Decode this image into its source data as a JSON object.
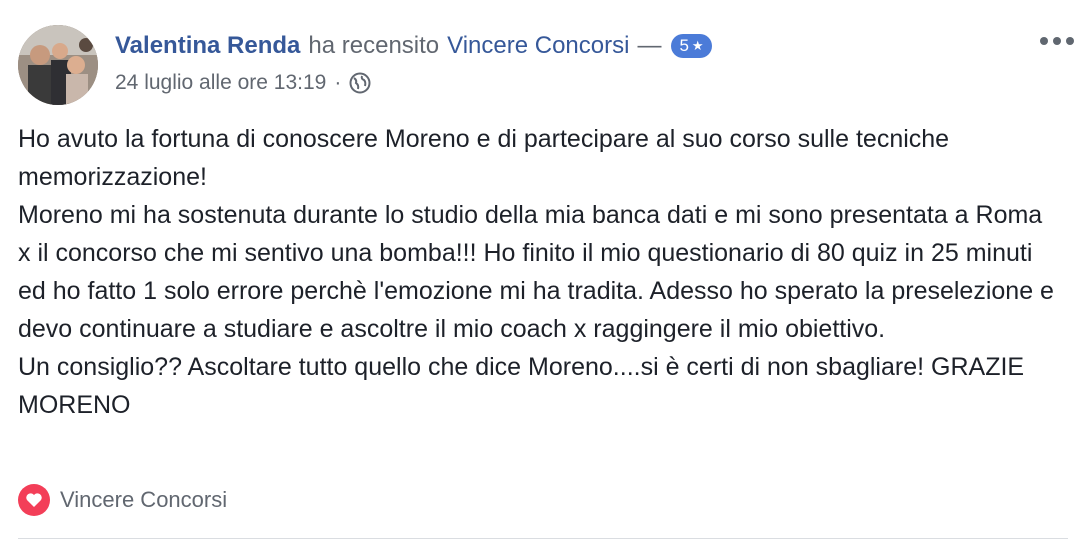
{
  "header": {
    "author": "Valentina Renda",
    "verb": "ha recensito",
    "page": "Vincere Concorsi",
    "dash": "—",
    "rating": "5",
    "rating_star": "★"
  },
  "meta": {
    "timestamp": "24 luglio alle ore 13:19",
    "separator": "·",
    "privacy_icon": "globe-icon"
  },
  "post": {
    "lines": [
      "Ho avuto la fortuna di conoscere Moreno e di partecipare al suo corso sulle tecniche memorizzazione!",
      "Moreno mi ha sostenuta durante lo studio della mia banca dati e mi sono presentata a Roma x il concorso che mi sentivo una bomba!!! Ho finito il mio questionario di 80 quiz in 25 minuti ed ho fatto 1 solo errore perchè l'emozione mi ha tradita. Adesso ho sperato la preselezione e devo continuare a studiare e ascoltre il mio coach x raggingere il mio obiettivo.",
      "Un consiglio?? Ascoltare tutto quello che dice Moreno....si è certi di non sbagliare! GRAZIE MORENO"
    ]
  },
  "reactions": {
    "icon": "heart-icon",
    "label": "Vincere Concorsi"
  },
  "colors": {
    "link": "#365899",
    "badge": "#4b7bd8",
    "heart": "#f33e58",
    "meta": "#616770"
  }
}
